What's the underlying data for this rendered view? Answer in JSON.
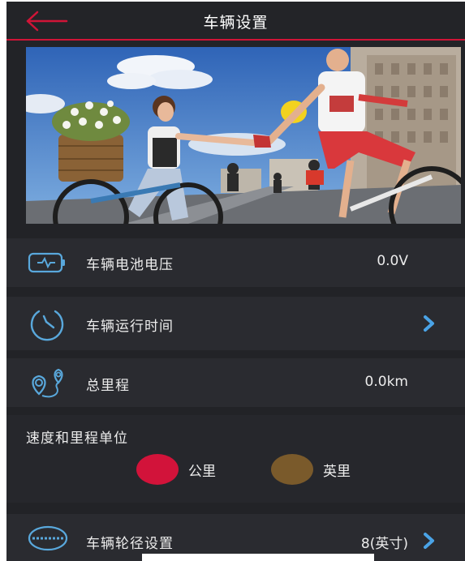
{
  "header": {
    "title": "车辆设置",
    "back_icon": "back-arrow-icon",
    "accent_color": "#d01437"
  },
  "banner": {
    "icon": "cyclists-photo"
  },
  "rows": [
    {
      "label": "车辆电池电压",
      "value": "0.0V",
      "icon": "battery-icon"
    },
    {
      "label": "车辆运行时间",
      "value": "",
      "icon": "timer-icon",
      "chevron": "chevron-right-icon"
    },
    {
      "label": "总里程",
      "value": "0.0km",
      "icon": "route-icon"
    }
  ],
  "units": {
    "title": "速度和里程单位",
    "options": [
      {
        "label": "公里",
        "color": "#d2133a",
        "selected": true
      },
      {
        "label": "英里",
        "color": "#7a5a2b",
        "selected": false
      }
    ]
  },
  "wheel": {
    "label": "车辆轮径设置",
    "value": "8(英寸)",
    "icon": "wheel-icon",
    "chevron": "chevron-right-icon"
  },
  "colors": {
    "background": "#222327",
    "chevron": "#4aa3e6",
    "icon_stroke": "#59a8dc"
  }
}
